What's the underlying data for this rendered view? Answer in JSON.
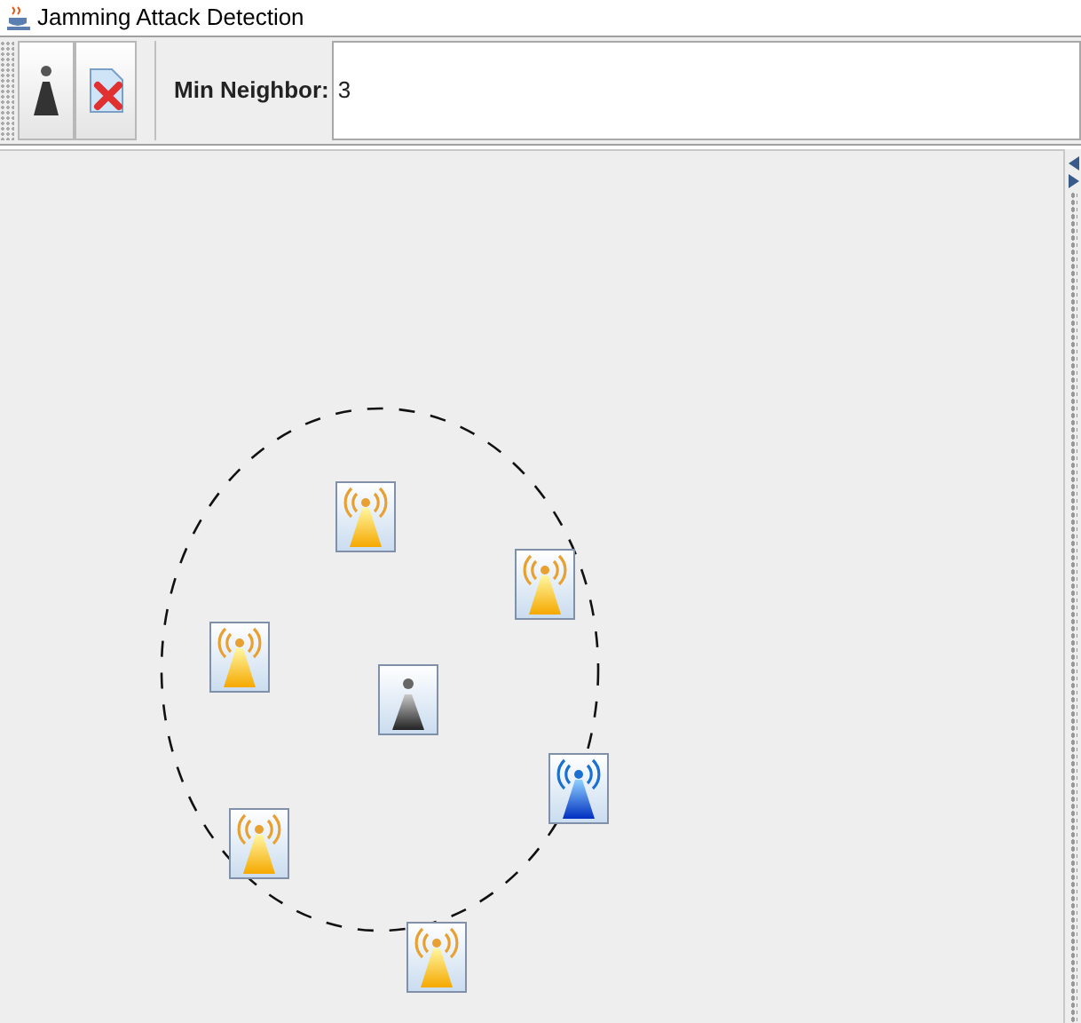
{
  "window": {
    "title": "Jamming Attack Detection"
  },
  "toolbar": {
    "min_neighbor": {
      "label": "Min Neighbor:",
      "value": "3"
    }
  },
  "canvas": {
    "nodes": [
      {
        "kind": "normal"
      },
      {
        "kind": "normal"
      },
      {
        "kind": "normal"
      },
      {
        "kind": "base"
      },
      {
        "kind": "jammed"
      },
      {
        "kind": "normal"
      },
      {
        "kind": "normal"
      }
    ]
  }
}
